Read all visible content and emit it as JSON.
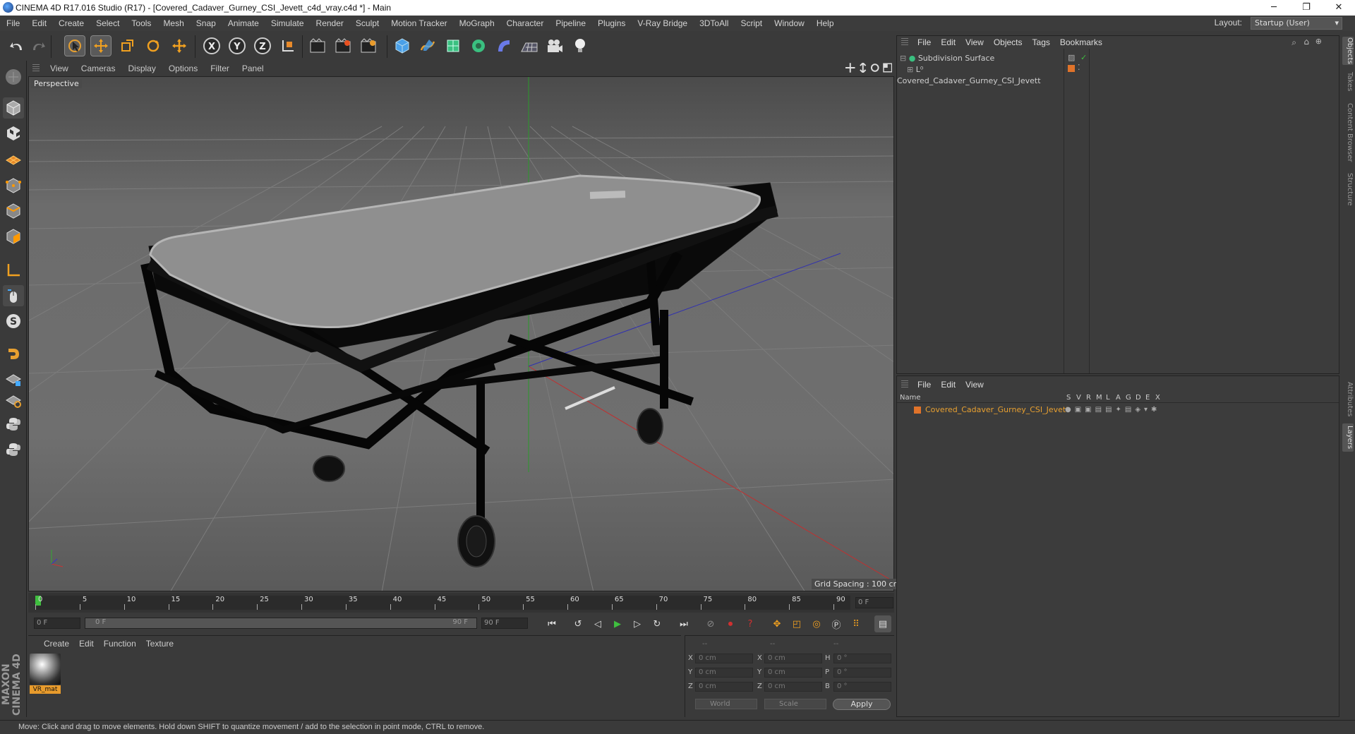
{
  "window": {
    "title": "CINEMA 4D R17.016 Studio (R17) - [Covered_Cadaver_Gurney_CSI_Jevett_c4d_vray.c4d *] - Main",
    "minimize": "─",
    "restore": "❐",
    "close": "✕"
  },
  "menubar": [
    "File",
    "Edit",
    "Create",
    "Select",
    "Tools",
    "Mesh",
    "Snap",
    "Animate",
    "Simulate",
    "Render",
    "Sculpt",
    "Motion Tracker",
    "MoGraph",
    "Character",
    "Pipeline",
    "Plugins",
    "V-Ray Bridge",
    "3DToAll",
    "Script",
    "Window",
    "Help"
  ],
  "layout": {
    "label": "Layout:",
    "value": "Startup (User)"
  },
  "toolbar": {
    "x_label": "X",
    "y_label": "Y",
    "z_label": "Z"
  },
  "viewport": {
    "menu": [
      "View",
      "Cameras",
      "Display",
      "Options",
      "Filter",
      "Panel"
    ],
    "label": "Perspective",
    "grid_spacing": "Grid Spacing : 100 cm"
  },
  "timeline": {
    "ticks": [
      "0",
      "5",
      "10",
      "15",
      "20",
      "25",
      "30",
      "35",
      "40",
      "45",
      "50",
      "55",
      "60",
      "65",
      "70",
      "75",
      "80",
      "85",
      "90"
    ],
    "current_frame": "0 F",
    "start_frame": "0 F",
    "range_start": "0 F",
    "range_end": "90 F",
    "end_frame": "90 F"
  },
  "material_manager": {
    "menu": [
      "Create",
      "Edit",
      "Function",
      "Texture"
    ],
    "materials": [
      {
        "name": "VR_mat"
      }
    ]
  },
  "branding": "MAXON CINEMA 4D",
  "coordinates": {
    "headers": [
      "--",
      "--",
      "--"
    ],
    "rows": [
      {
        "a": "X",
        "pos": "0 cm",
        "b": "X",
        "size": "0 cm",
        "c": "H",
        "rot": "0 °"
      },
      {
        "a": "Y",
        "pos": "0 cm",
        "b": "Y",
        "size": "0 cm",
        "c": "P",
        "rot": "0 °"
      },
      {
        "a": "Z",
        "pos": "0 cm",
        "b": "Z",
        "size": "0 cm",
        "c": "B",
        "rot": "0 °"
      }
    ],
    "mode": "World",
    "scale": "Scale",
    "apply": "Apply"
  },
  "object_manager": {
    "menu": [
      "File",
      "Edit",
      "View",
      "Objects",
      "Tags",
      "Bookmarks"
    ],
    "objects": [
      {
        "name": "Subdivision Surface"
      },
      {
        "name": "Covered_Cadaver_Gurney_CSI_Jevett"
      }
    ]
  },
  "layer_manager": {
    "menu": [
      "File",
      "Edit",
      "View"
    ],
    "columns": [
      "Name",
      "S",
      "V",
      "R",
      "M",
      "L",
      "A",
      "G",
      "D",
      "E",
      "X"
    ],
    "layers": [
      {
        "name": "Covered_Cadaver_Gurney_CSI_Jevett",
        "color": "#e0732a"
      }
    ]
  },
  "side_tabs": [
    "Objects",
    "Takes",
    "Content Browser",
    "Structure",
    "Attributes",
    "Layers"
  ],
  "status": "Move: Click and drag to move elements. Hold down SHIFT to quantize movement / add to the selection in point mode, CTRL to remove.",
  "colors": {
    "accent": "#e89b2c",
    "layer_orange": "#e0732a",
    "play_green": "#3fbf3f",
    "record_red": "#d03030"
  }
}
